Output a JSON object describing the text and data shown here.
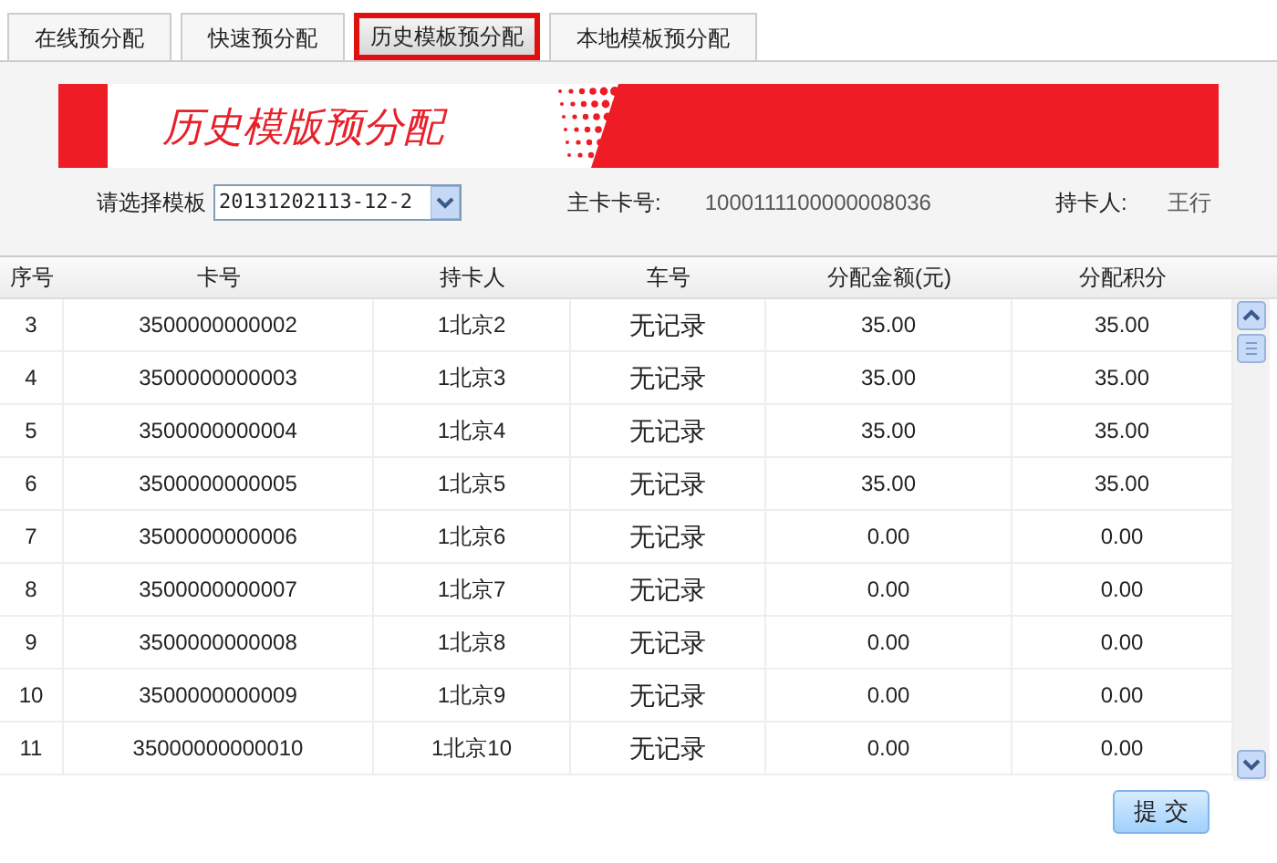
{
  "tabs": [
    {
      "label": "在线预分配",
      "selected": false
    },
    {
      "label": "快速预分配",
      "selected": false
    },
    {
      "label": "历史模板预分配",
      "selected": true
    },
    {
      "label": "本地模板预分配",
      "selected": false
    }
  ],
  "banner": {
    "title": "历史模版预分配"
  },
  "form": {
    "template_label": "请选择模板",
    "template_value": "20131202113-12-2",
    "main_card_label": "主卡卡号:",
    "main_card_value": "1000111100000008036",
    "holder_label": "持卡人:",
    "holder_value": "王行"
  },
  "table": {
    "columns": [
      "序号",
      "卡号",
      "持卡人",
      "车号",
      "分配金额(元)",
      "分配积分"
    ],
    "rows": [
      [
        "3",
        "3500000000002",
        "1北京2",
        "无记录",
        "35.00",
        "35.00"
      ],
      [
        "4",
        "3500000000003",
        "1北京3",
        "无记录",
        "35.00",
        "35.00"
      ],
      [
        "5",
        "3500000000004",
        "1北京4",
        "无记录",
        "35.00",
        "35.00"
      ],
      [
        "6",
        "3500000000005",
        "1北京5",
        "无记录",
        "35.00",
        "35.00"
      ],
      [
        "7",
        "3500000000006",
        "1北京6",
        "无记录",
        "0.00",
        "0.00"
      ],
      [
        "8",
        "3500000000007",
        "1北京7",
        "无记录",
        "0.00",
        "0.00"
      ],
      [
        "9",
        "3500000000008",
        "1北京8",
        "无记录",
        "0.00",
        "0.00"
      ],
      [
        "10",
        "3500000000009",
        "1北京9",
        "无记录",
        "0.00",
        "0.00"
      ],
      [
        "11",
        "35000000000010",
        "1北京10",
        "无记录",
        "0.00",
        "0.00"
      ]
    ]
  },
  "submit_button": "提 交"
}
